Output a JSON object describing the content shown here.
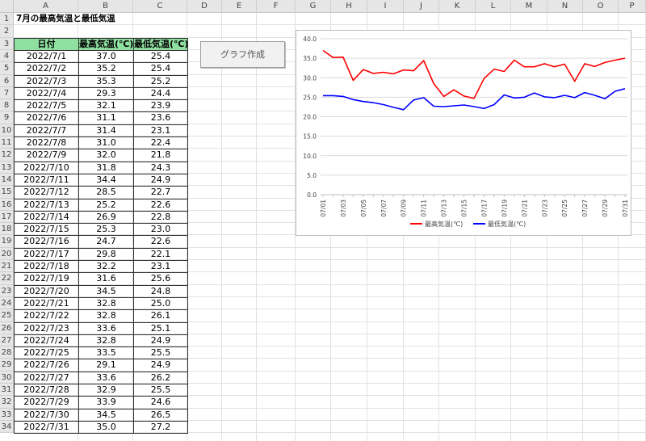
{
  "columns": [
    "A",
    "B",
    "C",
    "D",
    "E",
    "F",
    "G",
    "H",
    "I",
    "J",
    "K",
    "L",
    "M",
    "N",
    "O",
    "P"
  ],
  "rows": [
    "1",
    "2",
    "3",
    "4",
    "5",
    "6",
    "7",
    "8",
    "9",
    "10",
    "11",
    "12",
    "13",
    "14",
    "15",
    "16",
    "17",
    "18",
    "19",
    "20",
    "21",
    "22",
    "23",
    "24",
    "25",
    "26",
    "27",
    "28",
    "29",
    "30",
    "31",
    "32",
    "33",
    "34"
  ],
  "sheet": {
    "title": "7月の最高気温と最低気温",
    "headers": [
      "日付",
      "最高気温(℃)",
      "最低気温(℃)"
    ],
    "header_color": "#8fe0a0",
    "records": [
      [
        "2022/7/1",
        "37.0",
        "25.4"
      ],
      [
        "2022/7/2",
        "35.2",
        "25.4"
      ],
      [
        "2022/7/3",
        "35.3",
        "25.2"
      ],
      [
        "2022/7/4",
        "29.3",
        "24.4"
      ],
      [
        "2022/7/5",
        "32.1",
        "23.9"
      ],
      [
        "2022/7/6",
        "31.1",
        "23.6"
      ],
      [
        "2022/7/7",
        "31.4",
        "23.1"
      ],
      [
        "2022/7/8",
        "31.0",
        "22.4"
      ],
      [
        "2022/7/9",
        "32.0",
        "21.8"
      ],
      [
        "2022/7/10",
        "31.8",
        "24.3"
      ],
      [
        "2022/7/11",
        "34.4",
        "24.9"
      ],
      [
        "2022/7/12",
        "28.5",
        "22.7"
      ],
      [
        "2022/7/13",
        "25.2",
        "22.6"
      ],
      [
        "2022/7/14",
        "26.9",
        "22.8"
      ],
      [
        "2022/7/15",
        "25.3",
        "23.0"
      ],
      [
        "2022/7/16",
        "24.7",
        "22.6"
      ],
      [
        "2022/7/17",
        "29.8",
        "22.1"
      ],
      [
        "2022/7/18",
        "32.2",
        "23.1"
      ],
      [
        "2022/7/19",
        "31.6",
        "25.6"
      ],
      [
        "2022/7/20",
        "34.5",
        "24.8"
      ],
      [
        "2022/7/21",
        "32.8",
        "25.0"
      ],
      [
        "2022/7/22",
        "32.8",
        "26.1"
      ],
      [
        "2022/7/23",
        "33.6",
        "25.1"
      ],
      [
        "2022/7/24",
        "32.8",
        "24.9"
      ],
      [
        "2022/7/25",
        "33.5",
        "25.5"
      ],
      [
        "2022/7/26",
        "29.1",
        "24.9"
      ],
      [
        "2022/7/27",
        "33.6",
        "26.2"
      ],
      [
        "2022/7/28",
        "32.9",
        "25.5"
      ],
      [
        "2022/7/29",
        "33.9",
        "24.6"
      ],
      [
        "2022/7/30",
        "34.5",
        "26.5"
      ],
      [
        "2022/7/31",
        "35.0",
        "27.2"
      ]
    ]
  },
  "button": {
    "label": "グラフ作成"
  },
  "chart_data": {
    "type": "line",
    "x": [
      "07/01",
      "07/02",
      "07/03",
      "07/04",
      "07/05",
      "07/06",
      "07/07",
      "07/08",
      "07/09",
      "07/10",
      "07/11",
      "07/12",
      "07/13",
      "07/14",
      "07/15",
      "07/16",
      "07/17",
      "07/18",
      "07/19",
      "07/20",
      "07/21",
      "07/22",
      "07/23",
      "07/24",
      "07/25",
      "07/26",
      "07/27",
      "07/28",
      "07/29",
      "07/30",
      "07/31"
    ],
    "x_tick_labels": [
      "07/01",
      "07/03",
      "07/05",
      "07/07",
      "07/09",
      "07/11",
      "07/13",
      "07/15",
      "07/17",
      "07/19",
      "07/21",
      "07/23",
      "07/25",
      "07/27",
      "07/29",
      "07/31"
    ],
    "series": [
      {
        "name": "最高気温(℃)",
        "color": "#ff0000",
        "values": [
          37.0,
          35.2,
          35.3,
          29.3,
          32.1,
          31.1,
          31.4,
          31.0,
          32.0,
          31.8,
          34.4,
          28.5,
          25.2,
          26.9,
          25.3,
          24.7,
          29.8,
          32.2,
          31.6,
          34.5,
          32.8,
          32.8,
          33.6,
          32.8,
          33.5,
          29.1,
          33.6,
          32.9,
          33.9,
          34.5,
          35.0
        ]
      },
      {
        "name": "最低気温(℃)",
        "color": "#0000ff",
        "values": [
          25.4,
          25.4,
          25.2,
          24.4,
          23.9,
          23.6,
          23.1,
          22.4,
          21.8,
          24.3,
          24.9,
          22.7,
          22.6,
          22.8,
          23.0,
          22.6,
          22.1,
          23.1,
          25.6,
          24.8,
          25.0,
          26.1,
          25.1,
          24.9,
          25.5,
          24.9,
          26.2,
          25.5,
          24.6,
          26.5,
          27.2
        ]
      }
    ],
    "ylim": [
      0,
      40
    ],
    "y_ticks": [
      "0.0",
      "5.0",
      "10.0",
      "15.0",
      "20.0",
      "25.0",
      "30.0",
      "35.0",
      "40.0"
    ],
    "grid": true,
    "legend": "bottom"
  }
}
